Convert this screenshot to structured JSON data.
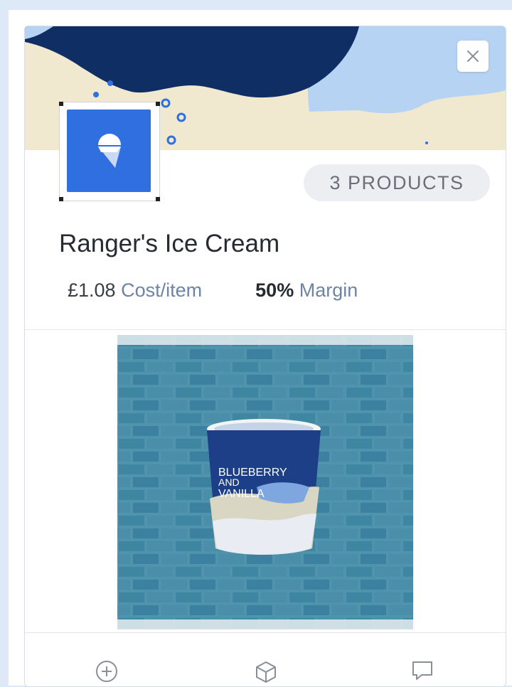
{
  "card": {
    "close_icon": "close-icon",
    "logo_icon": "ice-cream-cone-icon",
    "products_badge": "3 PRODUCTS",
    "name": "Ranger's Ice Cream",
    "cost_value": "£1.08",
    "cost_label": "Cost/item",
    "margin_value": "50%",
    "margin_label": "Margin"
  },
  "product_image": {
    "tub_text": [
      "BLUEBERRY",
      "AND",
      "VANILLA"
    ]
  },
  "actions": [
    {
      "icon": "add-circle-icon"
    },
    {
      "icon": "box-icon"
    },
    {
      "icon": "comment-icon"
    }
  ]
}
